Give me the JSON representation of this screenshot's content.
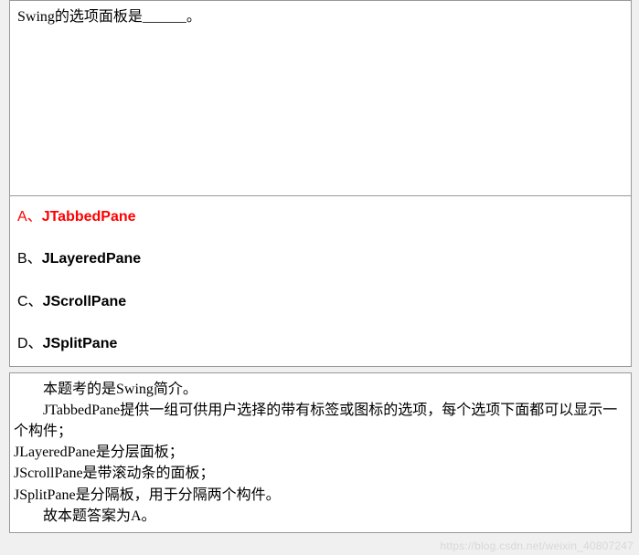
{
  "question": "Swing的选项面板是______。",
  "options": [
    {
      "label": "A、",
      "value": "JTabbedPane",
      "correct": true
    },
    {
      "label": "B、",
      "value": "JLayeredPane",
      "correct": false
    },
    {
      "label": "C、",
      "value": "JScrollPane",
      "correct": false
    },
    {
      "label": "D、",
      "value": "JSplitPane",
      "correct": false
    }
  ],
  "explanation": {
    "line1": "本题考的是Swing简介。",
    "line2": "JTabbedPane提供一组可供用户选择的带有标签或图标的选项，每个选项下面都可以显示一个构件；",
    "line3": "JLayeredPane是分层面板；",
    "line4": "JScrollPane是带滚动条的面板；",
    "line5": "JSplitPane是分隔板，用于分隔两个构件。",
    "line6": "故本题答案为A。"
  },
  "watermark": "https://blog.csdn.net/weixin_40807247"
}
